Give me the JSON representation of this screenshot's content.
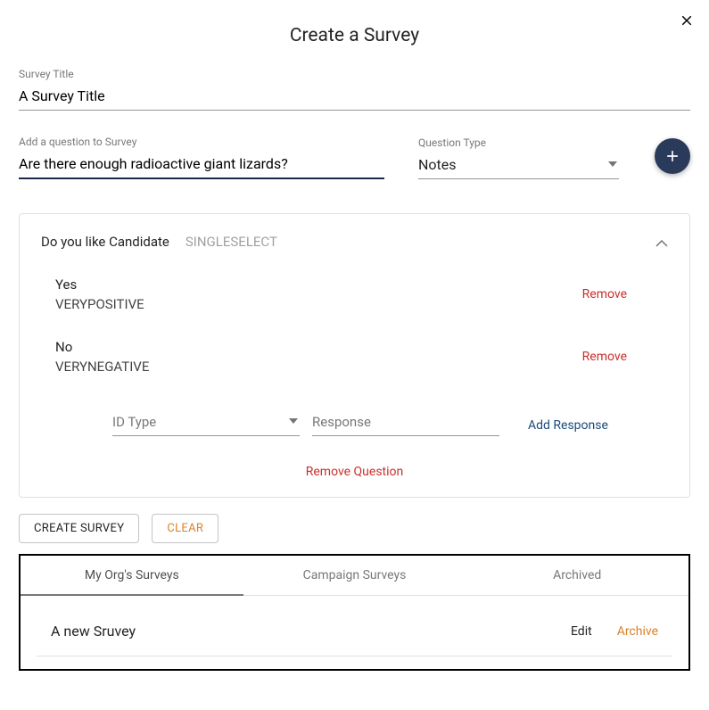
{
  "header": {
    "title": "Create a Survey"
  },
  "survey_title": {
    "label": "Survey Title",
    "value": "A Survey Title"
  },
  "add_question": {
    "label": "Add a question to Survey",
    "value": "Are there enough radioactive giant lizards?"
  },
  "question_type": {
    "label": "Question Type",
    "value": "Notes"
  },
  "question_card": {
    "title": "Do you like Candidate",
    "subtype": "SINGLESELECT",
    "responses": [
      {
        "label": "Yes",
        "id": "VERYPOSITIVE",
        "remove": "Remove"
      },
      {
        "label": "No",
        "id": "VERYNEGATIVE",
        "remove": "Remove"
      }
    ],
    "id_type_placeholder": "ID Type",
    "response_placeholder": "Response",
    "add_response": "Add Response",
    "remove_question": "Remove Question"
  },
  "actions": {
    "create": "CREATE SURVEY",
    "clear": "CLEAR"
  },
  "surveys_panel": {
    "tabs": [
      {
        "label": "My Org's Surveys",
        "active": true
      },
      {
        "label": "Campaign Surveys",
        "active": false
      },
      {
        "label": "Archived",
        "active": false
      }
    ],
    "rows": [
      {
        "name": "A new Sruvey",
        "edit": "Edit",
        "archive": "Archive"
      }
    ]
  }
}
